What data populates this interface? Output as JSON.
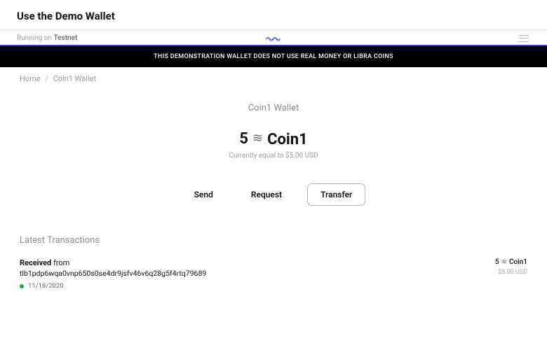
{
  "header": {
    "title": "Use the Demo Wallet"
  },
  "status": {
    "prefix": "Running on",
    "network": "Testnet"
  },
  "disclaimer": "THIS DEMONSTRATION WALLET DOES NOT USE REAL MONEY OR LIBRA COINS",
  "breadcrumb": {
    "home": "Home",
    "current": "Coin1 Wallet"
  },
  "wallet": {
    "title": "Coin1 Wallet",
    "balance_amount": "5",
    "balance_token": "Coin1",
    "sub_balance": "Currently equal to $5.00 USD"
  },
  "actions": {
    "send": "Send",
    "request": "Request",
    "transfer": "Transfer"
  },
  "transactions": {
    "section_title": "Latest Transactions",
    "items": [
      {
        "direction": "Received",
        "from_word": "from",
        "address": "tlb1pdp6wqa0vnp650s0se4dr9jsfv46v6q28g5f4rtq79689",
        "date": "11/18/2020",
        "amount": "5",
        "token": "Coin1",
        "fiat": "$5.00 USD"
      }
    ]
  },
  "colors": {
    "accent": "#3a37d6",
    "status_ok": "#1aa54a"
  }
}
